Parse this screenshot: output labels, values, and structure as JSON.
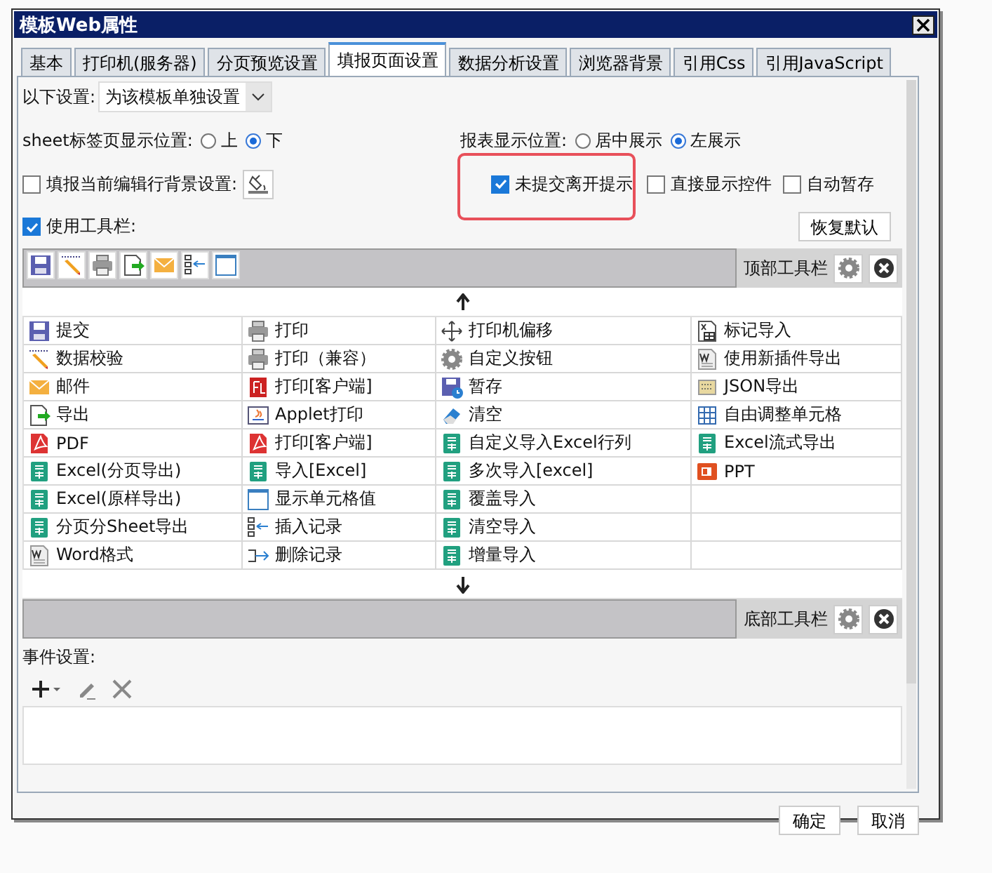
{
  "window": {
    "title": "模板Web属性"
  },
  "tabs": [
    {
      "label": "基本",
      "selected": false
    },
    {
      "label": "打印机(服务器)",
      "selected": false
    },
    {
      "label": "分页预览设置",
      "selected": false
    },
    {
      "label": "填报页面设置",
      "selected": true
    },
    {
      "label": "数据分析设置",
      "selected": false
    },
    {
      "label": "浏览器背景",
      "selected": false
    },
    {
      "label": "引用Css",
      "selected": false
    },
    {
      "label": "引用JavaScript",
      "selected": false
    }
  ],
  "scope": {
    "label": "以下设置:",
    "value": "为该模板单独设置"
  },
  "sheet_tab_position": {
    "label": "sheet标签页显示位置:",
    "options": [
      {
        "label": "上",
        "selected": false
      },
      {
        "label": "下",
        "selected": true
      }
    ]
  },
  "report_position": {
    "label": "报表显示位置:",
    "options": [
      {
        "label": "居中展示",
        "selected": false
      },
      {
        "label": "左展示",
        "selected": true
      }
    ]
  },
  "checkboxes": [
    {
      "label": "填报当前编辑行背景设置:",
      "checked": false,
      "kind": "with-button",
      "highlighted": false
    },
    {
      "label": "未提交离开提示",
      "checked": true,
      "kind": "plain",
      "highlighted": true
    },
    {
      "label": "直接显示控件",
      "checked": false,
      "kind": "plain",
      "highlighted": false
    },
    {
      "label": "自动暂存",
      "checked": false,
      "kind": "plain",
      "highlighted": false
    }
  ],
  "toolbar": {
    "label": "使用工具栏:",
    "checked": true,
    "reset_button": "恢复默认"
  },
  "top_toolbar": {
    "label": "顶部工具栏",
    "items": [
      {
        "kind": "save"
      },
      {
        "kind": "pencil"
      },
      {
        "kind": "print"
      },
      {
        "kind": "export"
      },
      {
        "kind": "mail"
      },
      {
        "kind": "insert"
      },
      {
        "kind": "cell"
      }
    ]
  },
  "button_columns": [
    [
      {
        "label": "提交",
        "kind": "save"
      },
      {
        "label": "数据校验",
        "kind": "pencil"
      },
      {
        "label": "邮件",
        "kind": "mail"
      },
      {
        "label": "导出",
        "kind": "export"
      },
      {
        "label": "PDF",
        "kind": "pdf"
      },
      {
        "label": "Excel(分页导出)",
        "kind": "excel"
      },
      {
        "label": "Excel(原样导出)",
        "kind": "excel"
      },
      {
        "label": "分页分Sheet导出",
        "kind": "excel"
      },
      {
        "label": "Word格式",
        "kind": "word"
      }
    ],
    [
      {
        "label": "打印",
        "kind": "print"
      },
      {
        "label": "打印（兼容）",
        "kind": "print"
      },
      {
        "label": "打印[客户端]",
        "kind": "flash"
      },
      {
        "label": "Applet打印",
        "kind": "applet"
      },
      {
        "label": "打印[客户端]",
        "kind": "pdf"
      },
      {
        "label": "导入[Excel]",
        "kind": "excel"
      },
      {
        "label": "显示单元格值",
        "kind": "cell"
      },
      {
        "label": "插入记录",
        "kind": "insert"
      },
      {
        "label": "删除记录",
        "kind": "delete"
      }
    ],
    [
      {
        "label": "打印机偏移",
        "kind": "move"
      },
      {
        "label": "自定义按钮",
        "kind": "gear"
      },
      {
        "label": "暂存",
        "kind": "save-clock"
      },
      {
        "label": "清空",
        "kind": "eraser"
      },
      {
        "label": "自定义导入Excel行列",
        "kind": "excel"
      },
      {
        "label": "多次导入[excel]",
        "kind": "excel"
      },
      {
        "label": "覆盖导入",
        "kind": "excel"
      },
      {
        "label": "清空导入",
        "kind": "excel"
      },
      {
        "label": "增量导入",
        "kind": "excel"
      }
    ],
    [
      {
        "label": "标记导入",
        "kind": "mark"
      },
      {
        "label": "使用新插件导出",
        "kind": "word"
      },
      {
        "label": "JSON导出",
        "kind": "json"
      },
      {
        "label": "自由调整单元格",
        "kind": "grid"
      },
      {
        "label": "Excel流式导出",
        "kind": "excel"
      },
      {
        "label": "PPT",
        "kind": "ppt"
      }
    ]
  ],
  "bottom_toolbar": {
    "label": "底部工具栏"
  },
  "events": {
    "label": "事件设置:"
  },
  "buttons": [
    "确定",
    "取消"
  ]
}
